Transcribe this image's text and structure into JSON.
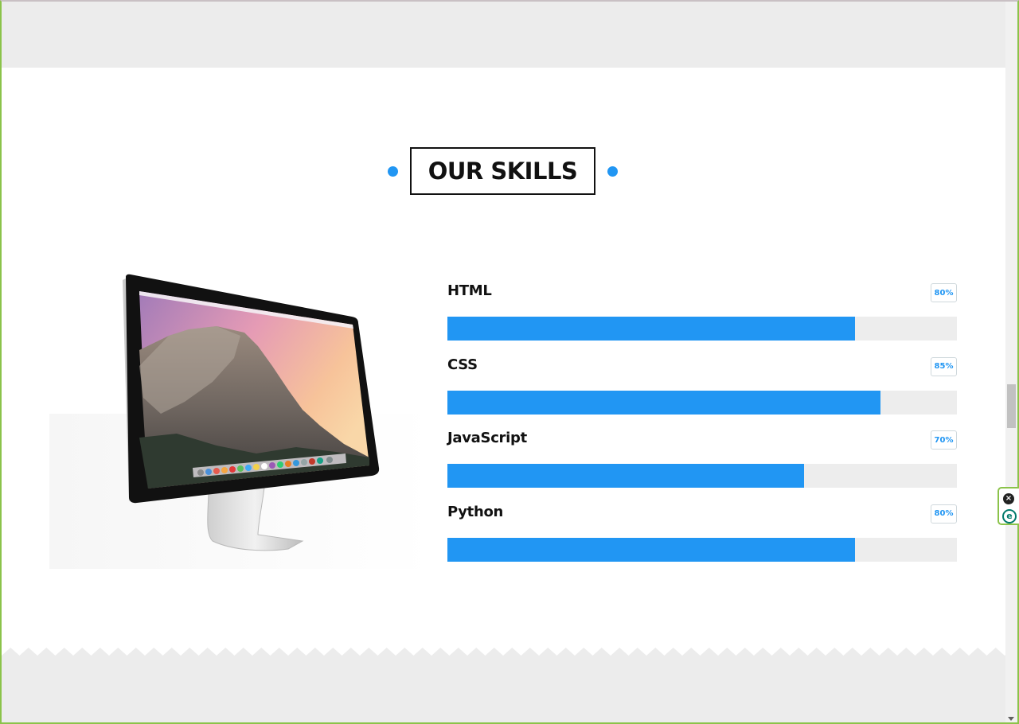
{
  "section": {
    "title": "OUR SKILLS"
  },
  "colors": {
    "accent": "#2196f3",
    "track": "#ededed",
    "band": "#ececec"
  },
  "skills": [
    {
      "name": "HTML",
      "percent_label": "80%",
      "level": 80
    },
    {
      "name": "CSS",
      "percent_label": "85%",
      "level": 85
    },
    {
      "name": "JavaScript",
      "percent_label": "70%",
      "level": 70
    },
    {
      "name": "Python",
      "percent_label": "80%",
      "level": 80
    }
  ],
  "widget": {
    "close_icon": "close-icon",
    "extension_icon": "e-icon",
    "close_glyph": "×",
    "e_glyph": "e"
  }
}
